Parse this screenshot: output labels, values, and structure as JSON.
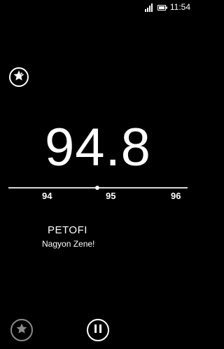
{
  "status_bar": {
    "time": "11:54",
    "icons": [
      "signal-icon",
      "battery-icon"
    ]
  },
  "radio": {
    "frequency": "94.8",
    "scale": {
      "ticks": [
        "94",
        "95",
        "96"
      ],
      "current_value": 94.8
    },
    "station_name": "PETOFI",
    "rds_text": "Nagyon Zene!"
  },
  "controls": {
    "add_favorite_icon": "star-plus-icon",
    "favorites_icon": "star-icon",
    "pause_icon": "pause-icon"
  },
  "colors": {
    "background": "#000000",
    "foreground": "#ffffff",
    "disabled": "#8a8a8a"
  }
}
